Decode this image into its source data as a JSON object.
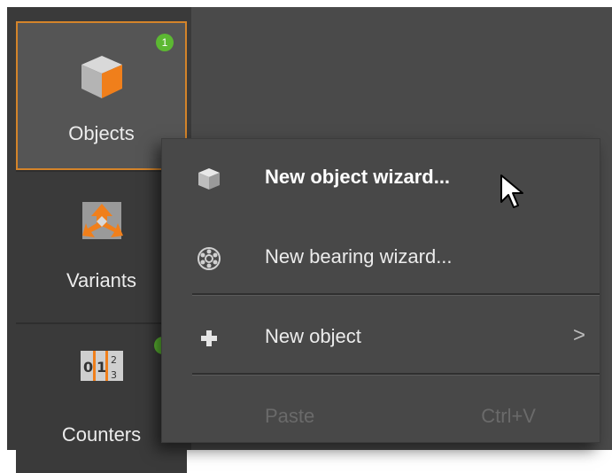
{
  "sidebar": {
    "items": [
      {
        "label": "Objects",
        "icon": "cube-icon",
        "badge": "1"
      },
      {
        "label": "Variants",
        "icon": "variants-icon"
      },
      {
        "label": "Counters",
        "icon": "counters-icon",
        "counter_digits": "0|1|2 3"
      }
    ]
  },
  "context_menu": {
    "items": [
      {
        "label": "New object wizard...",
        "icon": "cube-icon"
      },
      {
        "label": "New bearing wizard...",
        "icon": "bearing-icon"
      },
      {
        "label": "New object",
        "icon": "plus-icon",
        "submenu_indicator": ">"
      },
      {
        "label": "Paste",
        "shortcut": "Ctrl+V",
        "disabled": true
      }
    ]
  },
  "colors": {
    "accent": "#d4842a",
    "badge": "#5cb832",
    "background": "#4a4a4a",
    "sidebar": "#3a3a3a",
    "menu": "#484848"
  }
}
